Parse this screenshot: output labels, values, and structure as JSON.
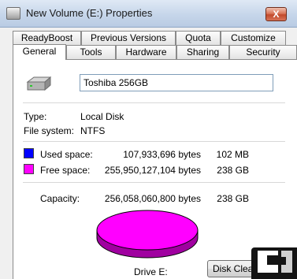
{
  "window": {
    "title": "New Volume (E:) Properties",
    "close_label": "X"
  },
  "tabs": {
    "row1": [
      "ReadyBoost",
      "Previous Versions",
      "Quota",
      "Customize"
    ],
    "row2": [
      "General",
      "Tools",
      "Hardware",
      "Sharing",
      "Security"
    ],
    "active": "General"
  },
  "general": {
    "volume_label": "Toshiba 256GB",
    "type_label": "Type:",
    "type_value": "Local Disk",
    "fs_label": "File system:",
    "fs_value": "NTFS",
    "used_label": "Used space:",
    "used_bytes": "107,933,696 bytes",
    "used_size": "102 MB",
    "free_label": "Free space:",
    "free_bytes": "255,950,127,104 bytes",
    "free_size": "238 GB",
    "capacity_label": "Capacity:",
    "capacity_bytes": "256,058,060,800 bytes",
    "capacity_size": "238 GB",
    "drive_label": "Drive E:",
    "disk_cleanup_button": "Disk Cleanup"
  },
  "colors": {
    "used": "#0000ff",
    "free": "#ff00ff",
    "free_dark": "#a000a0"
  },
  "icons": {
    "drive": "hard-drive-icon",
    "title": "drive-title-icon",
    "watermark": "legit-reviews-logo"
  }
}
